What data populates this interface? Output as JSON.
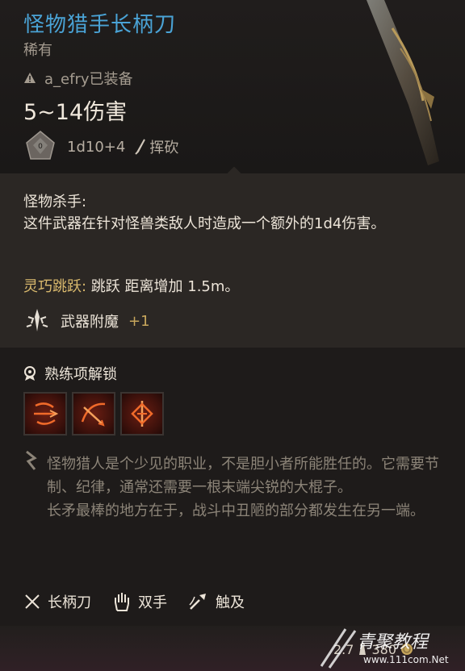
{
  "item": {
    "name": "怪物猎手长柄刀",
    "rarity": "稀有",
    "equipped_text": "a_efry已装备",
    "damage_total": "5~14伤害",
    "damage_roll": "1d10+4",
    "damage_type": "挥砍"
  },
  "passive": {
    "name": "怪物杀手:",
    "desc": "这件武器在针对怪兽类敌人时造成一个额外的1d4伤害。"
  },
  "jump": {
    "label": "灵巧跳跃: ",
    "effect": "跳跃 距离增加 1.5m。"
  },
  "enchant": {
    "label": "武器附魔",
    "bonus": "+1"
  },
  "proficiency": {
    "header": "熟练项解锁",
    "actions": [
      "action-1-icon",
      "action-2-icon",
      "action-3-icon"
    ]
  },
  "lore": {
    "text": "怪物猎人是个少见的职业，不是胆小者所能胜任的。它需要节制、纪律，通常还需要一根末端尖锐的大棍子。",
    "text2": "长矛最棒的地方在于，战斗中丑陋的部分都发生在另一端。"
  },
  "tags": [
    {
      "label": "长柄刀",
      "icon": "crossed-blades-icon"
    },
    {
      "label": "双手",
      "icon": "hand-icon"
    },
    {
      "label": "触及",
      "icon": "reach-icon"
    }
  ],
  "footer": {
    "weight": "2.7",
    "value": "380"
  },
  "watermark": {
    "brand": "青聚教程",
    "url": "www.111com.Net"
  },
  "colors": {
    "title": "#4aa3d6",
    "gold": "#d9b96d",
    "muted": "#a59c90",
    "panel": "#2b2724"
  }
}
